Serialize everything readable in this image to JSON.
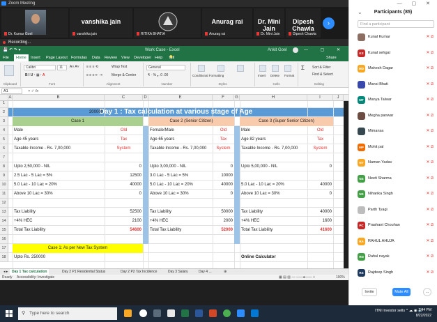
{
  "zoom": {
    "title": "Zoom Meeting",
    "recording": "Recording...",
    "video_tiles": [
      {
        "name": "vanshika jain",
        "caption": "vanshika jain",
        "caption_owner": "Dr. Kumar Goel"
      },
      {
        "name": "Anurag rai",
        "caption": "Anurag rai",
        "caption_owner": "RITIKA BHATIA"
      },
      {
        "name": "Dr. Mini Jain",
        "caption": "Dr. Mini Jain"
      },
      {
        "name": "Dipesh Chawla",
        "caption": "Dipesh Chawla"
      }
    ],
    "next_icon": "›"
  },
  "excel": {
    "title": "Work Case - Excel",
    "user": "Ankit Goel",
    "tell_me": "Tell me what you want to do",
    "share": "Share",
    "menu": [
      "File",
      "Home",
      "Insert",
      "Page Layout",
      "Formulas",
      "Data",
      "Review",
      "View",
      "Developer",
      "Help"
    ],
    "ribbon": {
      "font_name": "Calibri",
      "font_size": "11",
      "wrap": "Wrap Text",
      "merge": "Merge & Center",
      "number_format": "General",
      "conditional": "Conditional Formatting",
      "format_as_table": "Format as Table",
      "cell_styles": "Cell Styles",
      "insert": "Insert",
      "delete": "Delete",
      "format": "Format",
      "sort": "Sort & Filter",
      "find": "Find & Select",
      "groups": [
        "Clipboard",
        "Font",
        "Alignment",
        "Number",
        "Styles",
        "Cells",
        "Editing"
      ]
    },
    "namebox": "A1",
    "columns": [
      "A",
      "B",
      "C",
      "D",
      "E",
      "F",
      "G",
      "H",
      "I",
      "J"
    ],
    "rows": [
      "1",
      "2",
      "3",
      "4",
      "5",
      "6",
      "7",
      "8",
      "9",
      "10",
      "11",
      "12",
      "13",
      "14",
      "15",
      "16",
      "17",
      "18"
    ],
    "sheet": {
      "title": "Day 1 : Tax calculation at various stage of Age",
      "income": "200000",
      "case1": {
        "header": "Case 1",
        "rows": [
          [
            "Male",
            "Old"
          ],
          [
            "Age 45 years",
            "Tax"
          ],
          [
            "Taxable Income - Rs. 7,00,000",
            "System"
          ],
          [
            "",
            ""
          ],
          [
            "Upto 2,50,000 - NIL",
            "0"
          ],
          [
            "2.5 Lac - 5 Lac = 5%",
            "12500"
          ],
          [
            "5.0 Lac - 10 Lac = 20%",
            "40000"
          ],
          [
            "Above 10 Lac = 30%",
            "0"
          ],
          [
            "",
            ""
          ],
          [
            "Tax Liability",
            "52500"
          ],
          [
            "+4% HEC",
            "2100"
          ],
          [
            "Total Tax Liability",
            "54600"
          ]
        ]
      },
      "case2": {
        "header": "Case 2 (Senior Citizen)",
        "rows": [
          [
            "Female/Male",
            "Old"
          ],
          [
            "Age 65 years",
            "Tax"
          ],
          [
            "Taxable Income - Rs. 7,00,000",
            "System"
          ],
          [
            "",
            ""
          ],
          [
            "Upto 3,00,000 - NIL",
            "0"
          ],
          [
            "3.0 Lac - 5 Lac = 5%",
            "10000"
          ],
          [
            "5.0 Lac - 10 Lac = 20%",
            "40000"
          ],
          [
            "Above 10 Lac = 30%",
            "0"
          ],
          [
            "",
            ""
          ],
          [
            "Tax Liability",
            "50000"
          ],
          [
            "+4% HEC",
            "2000"
          ],
          [
            "Total Tax Liability",
            "52000"
          ]
        ]
      },
      "case3": {
        "header": "Case 3 (Super Senior Citizen)",
        "rows": [
          [
            "Male",
            "Old"
          ],
          [
            "Age 82 years",
            "Tax"
          ],
          [
            "Taxable Income - Rs. 7,00,000",
            "System"
          ],
          [
            "",
            ""
          ],
          [
            "Upto 5,00,000 - NIL",
            "0"
          ],
          [
            "",
            ""
          ],
          [
            "5.0 Lac - 10 Lac = 20%",
            "40000"
          ],
          [
            "Above 10 Lac = 30%",
            "0"
          ],
          [
            "",
            ""
          ],
          [
            "Tax Liability",
            "40000"
          ],
          [
            "+4% HEC",
            "1600"
          ],
          [
            "Total Tax Liability",
            "41600"
          ]
        ]
      },
      "new_tax_header": "Case 1: As per New Tax System",
      "row18": "Upto Rs. 250000",
      "online_calc": "Online Calculator"
    },
    "tabs": [
      "Day 1 Tax calculation",
      "Day 2 P1 Residential Status",
      "Day 2 P2 Tax Incidence",
      "Day 3 Salary",
      "Day 4 ..."
    ],
    "status": "Ready",
    "accessibility": "Accessibility: Investigate",
    "zoom_level": "100%"
  },
  "participants": {
    "title": "Participants (85)",
    "search_placeholder": "Find a participant",
    "list": [
      {
        "initials": "",
        "name": "Kunal Kumar",
        "color": "#8d6e63"
      },
      {
        "initials": "KS",
        "name": "Kunal sehgal",
        "color": "#c62828"
      },
      {
        "initials": "MD",
        "name": "Mahesh Dagar",
        "color": "#f9a825"
      },
      {
        "initials": "",
        "name": "Mansi Bhati",
        "color": "#3949ab"
      },
      {
        "initials": "MT",
        "name": "Manya Talwar",
        "color": "#00897b"
      },
      {
        "initials": "",
        "name": "Megha panwar",
        "color": "#6d4c41"
      },
      {
        "initials": "",
        "name": "Mimansa",
        "color": "#37474f"
      },
      {
        "initials": "MP",
        "name": "Mohit pal",
        "color": "#ef6c00"
      },
      {
        "initials": "NY",
        "name": "Naman Yadav",
        "color": "#f9a825"
      },
      {
        "initials": "NS",
        "name": "Neeti Sharma",
        "color": "#43a047"
      },
      {
        "initials": "NS",
        "name": "Niharika Singh",
        "color": "#43a047"
      },
      {
        "initials": "",
        "name": "Parth Tyagi",
        "color": "#bdbdbd"
      },
      {
        "initials": "PC",
        "name": "Prashant Chouhan",
        "color": "#c62828"
      },
      {
        "initials": "RA",
        "name": "RAHUL AHUJA",
        "color": "#f9a825"
      },
      {
        "initials": "RN",
        "name": "Rahul nayak",
        "color": "#43a047"
      },
      {
        "initials": "RS",
        "name": "Rajdeep Singh",
        "color": "#1e3a5f"
      }
    ],
    "invite": "Invite",
    "mute_all": "Mute All",
    "more": "..."
  },
  "taskbar": {
    "search": "Type here to search",
    "tray": "ITM Investor sells",
    "time": "2:44 PM",
    "date": "8/22/2022"
  },
  "colors": {
    "excel_green": "#217346",
    "title_blue": "#5b9bd5",
    "case1_green": "#a9d08e",
    "case2_peach": "#f8cbad",
    "zoom_blue": "#2d8cff",
    "red_text": "#e03030"
  }
}
